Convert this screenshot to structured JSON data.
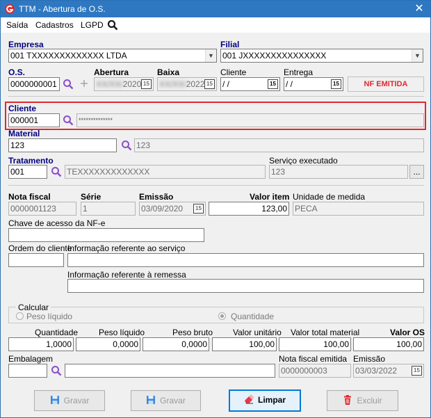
{
  "window": {
    "title": "TTM - Abertura de O.S.",
    "close": "✕"
  },
  "menu": {
    "saida": "Saída",
    "cadastros": "Cadastros",
    "lgpd": "LGPD"
  },
  "empresa": {
    "label": "Empresa",
    "value": "001 TXXXXXXXXXXXXX LTDA"
  },
  "filial": {
    "label": "Filial",
    "value": "001 JXXXXXXXXXXXXXXX"
  },
  "os": {
    "label": "O.S.",
    "value": "0000000001"
  },
  "abertura": {
    "label": "Abertura",
    "value": "11/11/2020",
    "value_suffix": "2020"
  },
  "baixa": {
    "label": "Baixa",
    "value": "01/01/2022",
    "value_suffix": "2022"
  },
  "cliente_date": {
    "label": "Cliente",
    "value": " /  /"
  },
  "entrega": {
    "label": "Entrega",
    "value": " /  /"
  },
  "nf_status": "NF EMITIDA",
  "cliente": {
    "label": "Cliente",
    "code": "000001",
    "name": "**************"
  },
  "material": {
    "label": "Material",
    "code": "123",
    "desc": "123"
  },
  "tratamento": {
    "label": "Tratamento",
    "code": "001",
    "desc": "TEXXXXXXXXXXXXX"
  },
  "servico": {
    "label": "Serviço executado",
    "value": "123",
    "btn": "..."
  },
  "nota_fiscal": {
    "label": "Nota fiscal",
    "value": "0000001123"
  },
  "serie": {
    "label": "Série",
    "value": "1"
  },
  "emissao": {
    "label": "Emissão",
    "value": "03/09/2020"
  },
  "valor_item": {
    "label": "Valor item",
    "value": "123,00"
  },
  "unidade": {
    "label": "Unidade de medida",
    "value": "PECA"
  },
  "chave": {
    "label": "Chave de acesso da NF-e",
    "value": ""
  },
  "ordem_cliente": {
    "label": "Ordem do cliente",
    "value": ""
  },
  "info_servico": {
    "label": "Informação referente ao serviço",
    "value": ""
  },
  "info_remessa": {
    "label": "Informação referente à remessa",
    "value": ""
  },
  "calcular": {
    "label": "Calcular",
    "opt1": "Peso líquido",
    "opt2": "Quantidade"
  },
  "totals": {
    "quantidade": {
      "label": "Quantidade",
      "value": "1,0000"
    },
    "peso_liquido": {
      "label": "Peso líquido",
      "value": "0,0000"
    },
    "peso_bruto": {
      "label": "Peso bruto",
      "value": "0,0000"
    },
    "valor_unitario": {
      "label": "Valor unitário",
      "value": "100,00"
    },
    "valor_total": {
      "label": "Valor total material",
      "value": "100,00"
    },
    "valor_os": {
      "label": "Valor OS",
      "value": "100,00"
    }
  },
  "embalagem": {
    "label": "Embalagem",
    "code": "",
    "desc": ""
  },
  "nf_emitida": {
    "label": "Nota fiscal emitida",
    "value": "0000000003"
  },
  "emissao2": {
    "label": "Emissão",
    "value": "03/03/2022"
  },
  "buttons": {
    "gravar1": "Gravar",
    "gravar2": "Gravar",
    "limpar": "Limpar",
    "excluir": "Excluir"
  },
  "colors": {
    "title_bar": "#2e78c2",
    "label_blue": "#000080",
    "highlight": "#e0282f",
    "search_icon": "#8a4fc9"
  }
}
